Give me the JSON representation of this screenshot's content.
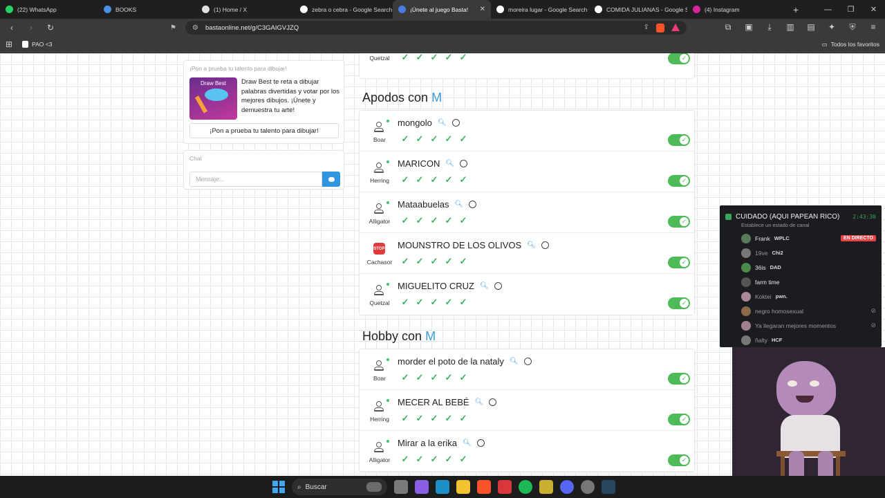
{
  "tabs": [
    {
      "label": "(22) WhatsApp",
      "color": "#25d366",
      "active": false
    },
    {
      "label": "BOOKS",
      "color": "#4a90e2",
      "active": false
    },
    {
      "label": "(1) Home / X",
      "color": "#e0e0e0",
      "active": false
    },
    {
      "label": "zebra o cebra - Google Search",
      "color": "#ffffff",
      "active": false
    },
    {
      "label": "¡Únete al juego Basta!",
      "color": "#4a7de2",
      "active": true
    },
    {
      "label": "moreira lugar - Google Search",
      "color": "#ffffff",
      "active": false
    },
    {
      "label": "COMIDA JULIANAS - Google S",
      "color": "#ffffff",
      "active": false
    },
    {
      "label": "(4) Instagram",
      "color": "#d6249f",
      "active": false
    }
  ],
  "url": "bastaonline.net/g/C3GAIGVJZQ",
  "bookmarks": {
    "item": "PAO <3",
    "all": "Todos los favoritos"
  },
  "promo": {
    "heading": "¡Pon a prueba tu talento para dibujar!",
    "thumb_label": "Draw Best",
    "text": "Draw Best te reta a dibujar palabras divertidas y votar por los mejores dibujos. ¡Únete y demuestra tu arte!",
    "cta": "¡Pon a prueba tu talento para dibujar!"
  },
  "chat": {
    "title": "Chat",
    "placeholder": "Mensaje..."
  },
  "top_partial": {
    "player": "Quetzal"
  },
  "sections": [
    {
      "title_prefix": "Apodos con",
      "letter": "M",
      "rows": [
        {
          "player": "Boar",
          "answer": "mongolo",
          "icon": "avatar"
        },
        {
          "player": "Herring",
          "answer": "MARICON",
          "icon": "avatar"
        },
        {
          "player": "Alligator",
          "answer": "Mataabuelas",
          "icon": "avatar"
        },
        {
          "player": "Cachasor",
          "answer": "MOUNSTRO DE LOS OLIVOS",
          "icon": "stop"
        },
        {
          "player": "Quetzal",
          "answer": "MIGUELITO CRUZ",
          "icon": "avatar"
        }
      ]
    },
    {
      "title_prefix": "Hobby con",
      "letter": "M",
      "rows": [
        {
          "player": "Boar",
          "answer": "morder el poto de la nataly",
          "icon": "avatar"
        },
        {
          "player": "Herring",
          "answer": "MECER AL BEBÉ",
          "icon": "avatar"
        },
        {
          "player": "Alligator",
          "answer": "Mirar a la erika",
          "icon": "avatar"
        }
      ]
    }
  ],
  "discord": {
    "channel": "CUIDADO (AQUI PAPEAN RICO)",
    "time": "2:43:30",
    "status": "Establece un estado de canal",
    "members": [
      {
        "name": "Frank",
        "tag": "WPLC",
        "badge": "EN DIRECTO",
        "dim": false,
        "color": "#5a7a5a"
      },
      {
        "name": "19ve",
        "tag": "Chi2",
        "badge": "",
        "dim": true,
        "color": "#777"
      },
      {
        "name": "36is",
        "tag": "DAD",
        "badge": "",
        "dim": false,
        "color": "#4a8a4a"
      },
      {
        "name": "farm time",
        "tag": "",
        "badge": "",
        "dim": false,
        "color": "#555"
      },
      {
        "name": "Koktei",
        "tag": "pwn.",
        "badge": "",
        "dim": true,
        "color": "#aa8899"
      },
      {
        "name": "negro homosexual",
        "tag": "",
        "badge": "",
        "dim": true,
        "color": "#8a6a4a",
        "muted": true
      },
      {
        "name": "Ya llegaran mejores momentos",
        "tag": "",
        "badge": "",
        "dim": true,
        "color": "#a08090",
        "muted": true
      },
      {
        "name": "ñalty",
        "tag": "HCF",
        "badge": "",
        "dim": true,
        "color": "#777"
      }
    ]
  },
  "taskbar": {
    "search": "Buscar"
  }
}
